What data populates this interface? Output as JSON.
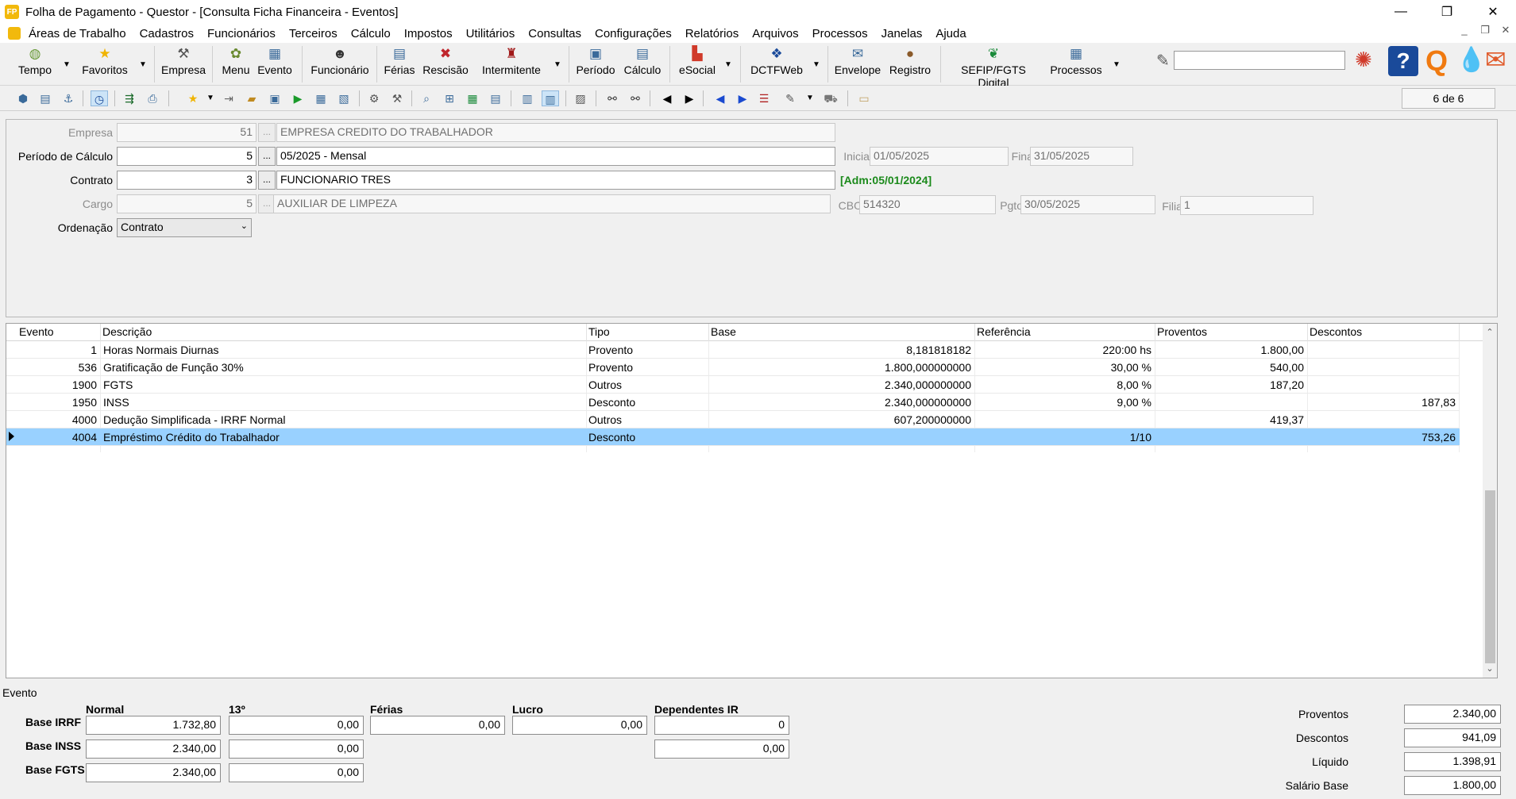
{
  "window": {
    "title": "Folha de Pagamento - Questor - [Consulta Ficha Financeira - Eventos]",
    "app_icon_text": "FP",
    "controls": [
      "—",
      "❐",
      "✕"
    ]
  },
  "menu": {
    "items": [
      "Áreas de Trabalho",
      "Cadastros",
      "Funcionários",
      "Terceiros",
      "Cálculo",
      "Impostos",
      "Utilitários",
      "Consultas",
      "Configurações",
      "Relatórios",
      "Arquivos",
      "Processos",
      "Janelas",
      "Ajuda"
    ],
    "mdi_controls": [
      "_",
      "❐",
      "✕"
    ]
  },
  "toolbar": {
    "buttons": [
      {
        "label": "Tempo",
        "icon": "clock-icon",
        "glyph": "◍",
        "color": "#6a9a3a"
      },
      {
        "label": "Favoritos",
        "icon": "star-icon",
        "glyph": "★",
        "color": "#f0b400"
      },
      {
        "label": "Empresa",
        "icon": "company-icon",
        "glyph": "⚒",
        "color": "#555"
      },
      {
        "label": "Menu",
        "icon": "menu-icon",
        "glyph": "✿",
        "color": "#6a8a30"
      },
      {
        "label": "Evento",
        "icon": "event-icon",
        "glyph": "▦",
        "color": "#3a6a9a"
      },
      {
        "label": "Funcionário",
        "icon": "employee-icon",
        "glyph": "☻",
        "color": "#333"
      },
      {
        "label": "Férias",
        "icon": "vacation-icon",
        "glyph": "▤",
        "color": "#3a6a9a"
      },
      {
        "label": "Rescisão",
        "icon": "termination-icon",
        "glyph": "✖",
        "color": "#c0262d"
      },
      {
        "label": "Intermitente",
        "icon": "intermittent-icon",
        "glyph": "♜",
        "color": "#a01818"
      },
      {
        "label": "Período",
        "icon": "period-icon",
        "glyph": "▣",
        "color": "#3a6a9a"
      },
      {
        "label": "Cálculo",
        "icon": "calculation-icon",
        "glyph": "▤",
        "color": "#3a6a9a"
      },
      {
        "label": "eSocial",
        "icon": "esocial-icon",
        "glyph": "▙",
        "color": "#d03a2a"
      },
      {
        "label": "DCTFWeb",
        "icon": "dctfweb-icon",
        "glyph": "❖",
        "color": "#1a4a9a"
      },
      {
        "label": "Envelope",
        "icon": "envelope-icon",
        "glyph": "✉",
        "color": "#3a6a9a"
      },
      {
        "label": "Registro",
        "icon": "register-icon",
        "glyph": "●",
        "color": "#8a5a2a"
      },
      {
        "label": "SEFIP/FGTS Digital",
        "icon": "sefip-icon",
        "glyph": "❦",
        "color": "#1a8a3a"
      },
      {
        "label": "Processos",
        "icon": "processes-icon",
        "glyph": "▦",
        "color": "#3a6a9a"
      }
    ],
    "search_placeholder": ""
  },
  "pager": {
    "text": "6 de 6"
  },
  "form": {
    "empresa": {
      "label": "Empresa",
      "code": "51",
      "name": "EMPRESA CREDITO DO TRABALHADOR"
    },
    "periodo": {
      "label": "Período de Cálculo",
      "code": "5",
      "name": "05/2025 - Mensal",
      "inicial_label": "Inicial",
      "inicial": "01/05/2025",
      "final_label": "Final",
      "final": "31/05/2025"
    },
    "contrato": {
      "label": "Contrato",
      "code": "3",
      "name": "FUNCIONARIO TRES",
      "adm": "[Adm:05/01/2024]"
    },
    "cargo": {
      "label": "Cargo",
      "code": "5",
      "name": "AUXILIAR DE LIMPEZA",
      "cbo_label": "CBO",
      "cbo": "514320",
      "pgto_label": "Pgto",
      "pgto": "30/05/2025",
      "filial_label": "Filial",
      "filial": "1"
    },
    "ordenacao": {
      "label": "Ordenação",
      "value": "Contrato"
    },
    "dots": "..."
  },
  "grid": {
    "columns": [
      "Evento",
      "Descrição",
      "Tipo",
      "Base",
      "Referência",
      "Proventos",
      "Descontos"
    ],
    "rows": [
      {
        "evento": "1",
        "descricao": "Horas Normais Diurnas",
        "tipo": "Provento",
        "base": "8,181818182",
        "referencia": "220:00 hs",
        "proventos": "1.800,00",
        "descontos": ""
      },
      {
        "evento": "536",
        "descricao": "Gratificação de Função 30%",
        "tipo": "Provento",
        "base": "1.800,000000000",
        "referencia": "30,00 %",
        "proventos": "540,00",
        "descontos": ""
      },
      {
        "evento": "1900",
        "descricao": "FGTS",
        "tipo": "Outros",
        "base": "2.340,000000000",
        "referencia": "8,00 %",
        "proventos": "187,20",
        "descontos": ""
      },
      {
        "evento": "1950",
        "descricao": "INSS",
        "tipo": "Desconto",
        "base": "2.340,000000000",
        "referencia": "9,00 %",
        "proventos": "",
        "descontos": "187,83"
      },
      {
        "evento": "4000",
        "descricao": "Dedução Simplificada - IRRF Normal",
        "tipo": "Outros",
        "base": "607,200000000",
        "referencia": "",
        "proventos": "419,37",
        "descontos": ""
      },
      {
        "evento": "4004",
        "descricao": "Empréstimo Crédito do Trabalhador",
        "tipo": "Desconto",
        "base": "",
        "referencia": "1/10",
        "proventos": "",
        "descontos": "753,26"
      }
    ],
    "selected_index": 5
  },
  "summary": {
    "title": "Evento",
    "columns": [
      "Normal",
      "13º",
      "Férias",
      "Lucro",
      "Dependentes IR"
    ],
    "base_irrf": {
      "label": "Base IRRF",
      "normal": "1.732,80",
      "decimo": "0,00",
      "ferias": "0,00",
      "lucro": "0,00",
      "dependentes": "0"
    },
    "base_inss": {
      "label": "Base INSS",
      "normal": "2.340,00",
      "decimo": "0,00",
      "dependentes": "0,00"
    },
    "base_fgts": {
      "label": "Base FGTS",
      "normal": "2.340,00",
      "decimo": "0,00"
    },
    "totals": [
      {
        "label": "Proventos",
        "value": "2.340,00"
      },
      {
        "label": "Descontos",
        "value": "941,09"
      },
      {
        "label": "Líquido",
        "value": "1.398,91"
      },
      {
        "label": "Salário Base",
        "value": "1.800,00"
      }
    ]
  }
}
